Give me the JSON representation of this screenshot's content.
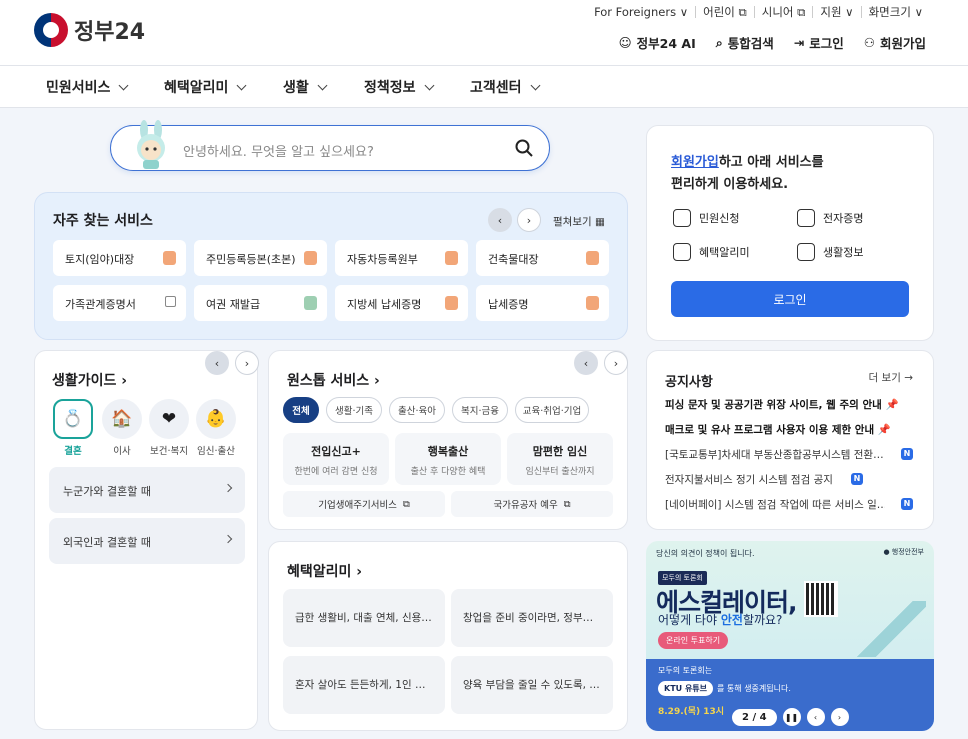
{
  "logo": {
    "text": "정부24"
  },
  "util_nav": [
    "For Foreigners ∨",
    "어린이 ⧉",
    "시니어 ⧉",
    "지원 ∨",
    "화면크기 ∨"
  ],
  "top_nav": {
    "ai": "정부24 AI",
    "search": "통합검색",
    "login": "로그인",
    "signup": "회원가입"
  },
  "main_nav": [
    "민원서비스",
    "혜택알리미",
    "생활",
    "정책정보",
    "고객센터"
  ],
  "search": {
    "placeholder": "안녕하세요. 무엇을 알고 싶으세요?"
  },
  "frequent": {
    "title": "자주 찾는 서비스",
    "expand": "펼쳐보기 ▦",
    "prev": "‹",
    "next": "›",
    "items": [
      "토지(임야)대장",
      "주민등록등본(초본)",
      "자동차등록원부",
      "건축물대장",
      "가족관계증명서",
      "여권 재발급",
      "지방세 납세증명",
      "납세증명"
    ]
  },
  "life_guide": {
    "title": "생활가이드",
    "categories": [
      "결혼",
      "이사",
      "보건·복지",
      "임신·출산",
      "…"
    ],
    "items": [
      "누군가와 결혼할 때",
      "외국인과 결혼할 때"
    ]
  },
  "onestop": {
    "title": "원스톱 서비스",
    "tabs": [
      "전체",
      "생활·기족",
      "출산·육아",
      "복지·금융",
      "교육·취업·기업"
    ],
    "cards": [
      {
        "title": "전입신고+",
        "sub": "한번에 여러 감면 신청"
      },
      {
        "title": "행복출산",
        "sub": "출산 후 다양한 혜택"
      },
      {
        "title": "맘편한 임신",
        "sub": "임신부터 출산까지"
      }
    ],
    "links": [
      "기업생애주기서비스",
      "국가유공자 예우"
    ]
  },
  "benefit": {
    "title": "혜택알리미",
    "items": [
      "급한 생활비, 대출 연체, 신용…",
      "창업을 준비 중이라면, 정부…",
      "혼자 살아도 든든하게, 1인 …",
      "양육 부담을 줄일 수 있도록, …"
    ]
  },
  "login_box": {
    "msg_link": "회원가입",
    "msg_rest1": "하고 아래 서비스를",
    "msg_line2": "편리하게 이용하세요.",
    "services": [
      "민원신청",
      "전자증명",
      "혜택알리미",
      "생활정보"
    ],
    "button": "로그인"
  },
  "notice": {
    "title": "공지사항",
    "more": "더 보기 →",
    "items": [
      {
        "text": "피싱 문자 및 공공기관 위장 사이트, 웹 주의 안내",
        "bold": true
      },
      {
        "text": "매크로 및 유사 프로그램 사용자 이용 제한 안내",
        "bold": true
      },
      {
        "text": "[국토교통부]차세대 부동산종합공부시스템 전환…",
        "bold": false
      },
      {
        "text": "전자지불서비스 정기 시스템 점검 공지",
        "bold": false
      },
      {
        "text": "[네이버페이] 시스템 점검 작업에 따른 서비스 일…",
        "bold": false
      }
    ],
    "badge": "N"
  },
  "banner": {
    "top": "당신의 의견이 정책이 됩니다.",
    "org": "● 행정안전부",
    "tag": "모두의 토론회",
    "headline": "에스컬레이터,",
    "sub_a": "어떻게 타야 ",
    "sub_b": "안전",
    "sub_c": "할까요?",
    "cta": "온라인 투표하기",
    "bottom1": "모두의 토론회는",
    "ktu": "KTU 유튜브",
    "bottom2": "를 통해 생중계됩니다.",
    "date": "8.29.(목) 13시",
    "pager": "2 / 4"
  }
}
